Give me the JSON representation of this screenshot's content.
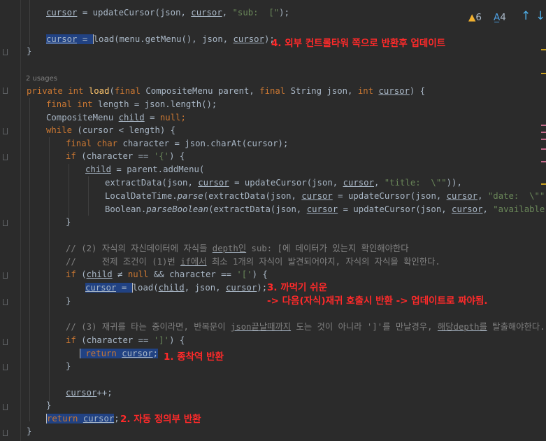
{
  "inspection": {
    "warnings": "6",
    "typos": "4"
  },
  "usages_hint": "2 usages",
  "annotations": {
    "a4": "4. 외부 컨트롤타워 쪽으로 반환후 업데이트",
    "a3_line1": "3. 까먹기 쉬운",
    "a3_line2": "-> 다음(자식)재귀 호출시 반환 -> 업데이트로 짜야됨.",
    "a1": "1. 종착역 반환",
    "a2": "2. 자동 정의부 반환"
  },
  "code_lines": [
    {
      "tokens": [
        {
          "t": "cursor",
          "c": "udl"
        },
        {
          "t": " = updateCursor(json, "
        },
        {
          "t": "cursor",
          "c": "udl"
        },
        {
          "t": ", "
        },
        {
          "t": "\"sub:  [\"",
          "c": "str"
        },
        {
          "t": ");"
        }
      ]
    },
    {
      "tokens": [
        {
          "t": "cursor",
          "c": "sel udl"
        },
        {
          "t": " = ",
          "c": "sel"
        },
        {
          "t": "load(menu.getMenu(), json, ",
          "c": "cursorbar"
        },
        {
          "t": "cursor",
          "c": "udl"
        },
        {
          "t": ");"
        }
      ]
    },
    {
      "tokens": [
        {
          "t": "}"
        }
      ]
    },
    {
      "tokens": [
        {
          "t": "private ",
          "c": "kw"
        },
        {
          "t": "int ",
          "c": "kw"
        },
        {
          "t": "load",
          "c": "mth"
        },
        {
          "t": "("
        },
        {
          "t": "final ",
          "c": "kw"
        },
        {
          "t": "CompositeMenu parent, "
        },
        {
          "t": "final ",
          "c": "kw"
        },
        {
          "t": "String json, "
        },
        {
          "t": "int ",
          "c": "kw"
        },
        {
          "t": "cursor",
          "c": "udl"
        },
        {
          "t": ") {"
        }
      ]
    },
    {
      "tokens": [
        {
          "t": "final ",
          "c": "kw"
        },
        {
          "t": "int ",
          "c": "kw"
        },
        {
          "t": "length = json.length();"
        }
      ]
    },
    {
      "tokens": [
        {
          "t": "CompositeMenu "
        },
        {
          "t": "child",
          "c": "udl"
        },
        {
          "t": " = "
        },
        {
          "t": "null",
          "c": "kw"
        },
        {
          "t": ";",
          "c": "kw"
        }
      ]
    },
    {
      "tokens": [
        {
          "t": "while ",
          "c": "kw"
        },
        {
          "t": "(cursor < length) {"
        }
      ]
    },
    {
      "tokens": [
        {
          "t": "final ",
          "c": "kw"
        },
        {
          "t": "char ",
          "c": "kw"
        },
        {
          "t": "character = json.charAt(cursor);"
        }
      ]
    },
    {
      "tokens": [
        {
          "t": "if ",
          "c": "kw"
        },
        {
          "t": "(character == "
        },
        {
          "t": "'{'",
          "c": "str"
        },
        {
          "t": ") {"
        }
      ]
    },
    {
      "tokens": [
        {
          "t": "child",
          "c": "udl"
        },
        {
          "t": " = parent.addMenu("
        }
      ]
    },
    {
      "tokens": [
        {
          "t": "extractData(json, "
        },
        {
          "t": "cursor",
          "c": "udl"
        },
        {
          "t": " = updateCursor(json, "
        },
        {
          "t": "cursor",
          "c": "udl"
        },
        {
          "t": ", "
        },
        {
          "t": "\"title:  \\\"\"",
          "c": "str"
        },
        {
          "t": ")),"
        }
      ]
    },
    {
      "tokens": [
        {
          "t": "LocalDateTime."
        },
        {
          "t": "parse",
          "c": "ital"
        },
        {
          "t": "(extractData(json, "
        },
        {
          "t": "cursor",
          "c": "udl"
        },
        {
          "t": " = updateCursor(json, "
        },
        {
          "t": "cursor",
          "c": "udl"
        },
        {
          "t": ", "
        },
        {
          "t": "\"date:  \\\"\"",
          "c": "str"
        },
        {
          "t": "))),"
        }
      ]
    },
    {
      "tokens": [
        {
          "t": "Boolean."
        },
        {
          "t": "parseBoolean",
          "c": "ital"
        },
        {
          "t": "(extractData(json, "
        },
        {
          "t": "cursor",
          "c": "udl"
        },
        {
          "t": " = updateCursor(json, "
        },
        {
          "t": "cursor",
          "c": "udl"
        },
        {
          "t": ", "
        },
        {
          "t": "\"available:  \\\"",
          "c": "str"
        }
      ]
    },
    {
      "tokens": [
        {
          "t": "}"
        }
      ]
    },
    {
      "tokens": [
        {
          "t": "// (2) 자식의 자신데이터에 자식들 ",
          "c": "cmt"
        },
        {
          "t": "depth인",
          "c": "cmt udl"
        },
        {
          "t": " sub: [에 데이터가 있는지 확인해야한다",
          "c": "cmt"
        }
      ]
    },
    {
      "tokens": [
        {
          "t": "//     전제 조건이 (1)번 ",
          "c": "cmt"
        },
        {
          "t": "if에서",
          "c": "cmt udl"
        },
        {
          "t": " 최소 1개의 자식이 발견되어야지, 자식의 자식을 확인한다.",
          "c": "cmt"
        }
      ]
    },
    {
      "tokens": [
        {
          "t": "if ",
          "c": "kw"
        },
        {
          "t": "("
        },
        {
          "t": "child",
          "c": "udl"
        },
        {
          "t": " ≠ "
        },
        {
          "t": "null ",
          "c": "kw"
        },
        {
          "t": "&& character == "
        },
        {
          "t": "'['",
          "c": "str"
        },
        {
          "t": ") {"
        }
      ]
    },
    {
      "tokens": [
        {
          "t": "cursor",
          "c": "sel udl"
        },
        {
          "t": " = ",
          "c": "sel"
        },
        {
          "t": "load(",
          "c": "cursorbar"
        },
        {
          "t": "child",
          "c": "udl"
        },
        {
          "t": ", json, "
        },
        {
          "t": "cursor",
          "c": "udl"
        },
        {
          "t": ");"
        }
      ]
    },
    {
      "tokens": [
        {
          "t": "}"
        }
      ]
    },
    {
      "tokens": [
        {
          "t": "// (3) 재귀를 타는 중이라면, 반복문이 ",
          "c": "cmt"
        },
        {
          "t": "json끝날때까지",
          "c": "cmt udl"
        },
        {
          "t": " 도는 것이 아니라 ']'를 만날경우, ",
          "c": "cmt"
        },
        {
          "t": "해당depth를",
          "c": "cmt udl"
        },
        {
          "t": " 탈출해야한다.",
          "c": "cmt"
        }
      ]
    },
    {
      "tokens": [
        {
          "t": "if ",
          "c": "kw"
        },
        {
          "t": "(character == "
        },
        {
          "t": "']'",
          "c": "str"
        },
        {
          "t": ") {"
        }
      ]
    },
    {
      "tokens": [
        {
          "t": " return ",
          "c": "kw sel cursorbar"
        },
        {
          "t": "cursor",
          "c": "sel udl"
        },
        {
          "t": ";",
          "c": "sel"
        }
      ]
    },
    {
      "tokens": [
        {
          "t": "}"
        }
      ]
    },
    {
      "tokens": [
        {
          "t": "cursor",
          "c": "udl"
        },
        {
          "t": "++;"
        }
      ]
    },
    {
      "tokens": [
        {
          "t": "}"
        }
      ]
    },
    {
      "tokens": [
        {
          "t": "return ",
          "c": "kw sel cursorbar"
        },
        {
          "t": "cursor",
          "c": "sel udl"
        },
        {
          "t": ";"
        }
      ]
    },
    {
      "tokens": [
        {
          "t": "}"
        }
      ]
    }
  ]
}
